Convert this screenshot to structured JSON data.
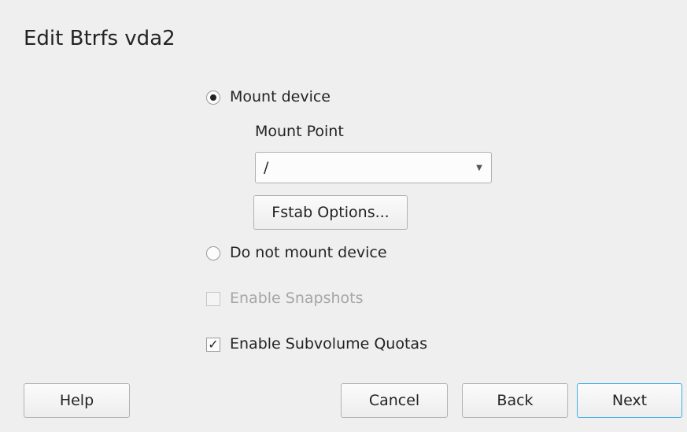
{
  "dialog": {
    "title": "Edit Btrfs vda2"
  },
  "mount": {
    "mount_device_label": "Mount device",
    "mount_device_selected": true,
    "mount_point_label": "Mount Point",
    "mount_point_value": "/",
    "fstab_button": "Fstab Options...",
    "do_not_mount_label": "Do not mount device",
    "do_not_mount_selected": false
  },
  "options": {
    "enable_snapshots_label": "Enable Snapshots",
    "enable_snapshots_checked": false,
    "enable_snapshots_disabled": true,
    "enable_quotas_label": "Enable Subvolume Quotas",
    "enable_quotas_checked": true
  },
  "buttons": {
    "help": "Help",
    "cancel": "Cancel",
    "back": "Back",
    "next": "Next"
  },
  "colors": {
    "background": "#efefef",
    "focus_accent": "#3daee9",
    "text": "#232323",
    "disabled_text": "#a6a6a6"
  }
}
